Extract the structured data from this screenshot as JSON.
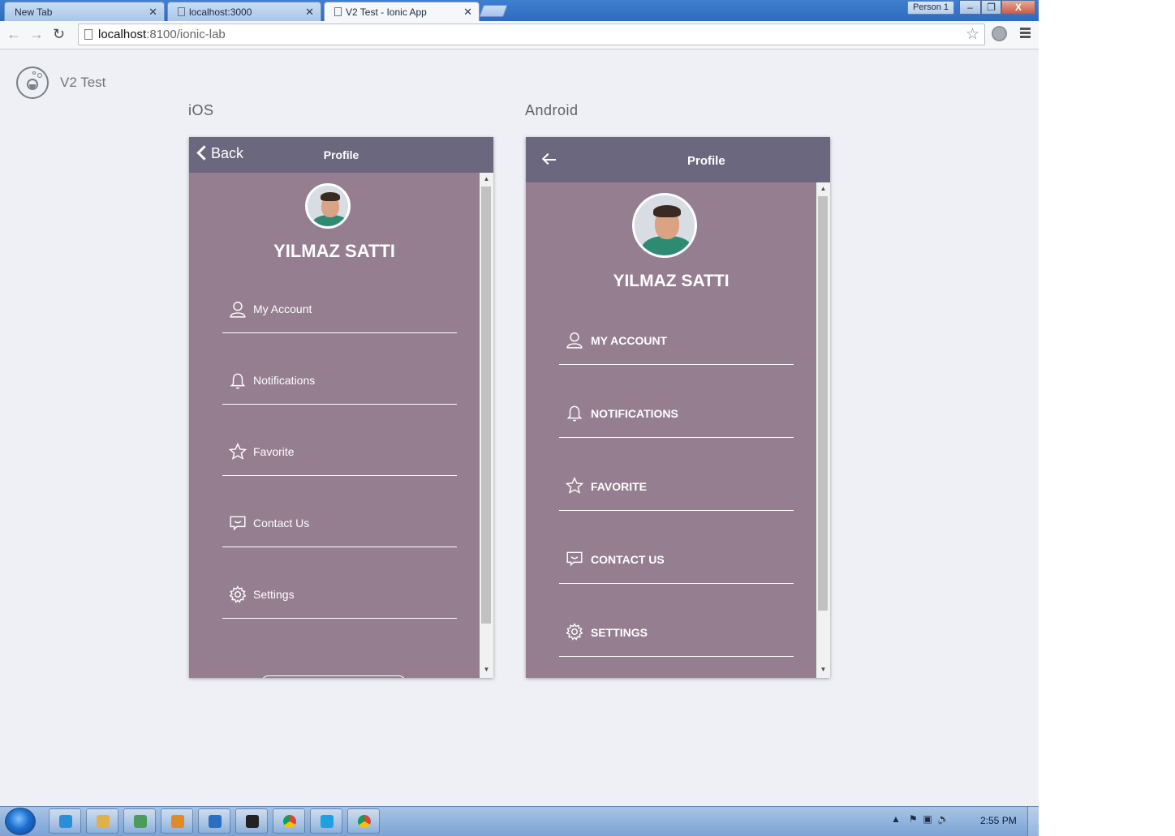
{
  "browser": {
    "tabs": [
      {
        "label": "New Tab",
        "active": false
      },
      {
        "label": "localhost:3000",
        "active": false
      },
      {
        "label": "V2 Test - Ionic App",
        "active": true
      }
    ],
    "profile": "Person 1",
    "window_buttons": {
      "minimize": "–",
      "restore": "❐",
      "close": "X"
    },
    "url_host": "localhost",
    "url_rest": ":8100/ionic-lab"
  },
  "lab": {
    "app_name": "V2 Test",
    "platforms": {
      "ios": {
        "label": "iOS",
        "back_label": "Back",
        "title": "Profile"
      },
      "android": {
        "label": "Android",
        "title": "Profile"
      }
    }
  },
  "profile": {
    "name": "YILMAZ SATTI",
    "menu_ios": [
      "My Account",
      "Notifications",
      "Favorite",
      "Contact Us",
      "Settings"
    ],
    "menu_android": [
      "MY ACCOUNT",
      "NOTIFICATIONS",
      "FAVORITE",
      "CONTACT US",
      "SETTINGS"
    ],
    "menu_icons": [
      "person-icon",
      "bell-icon",
      "star-icon",
      "chat-icon",
      "gear-icon"
    ]
  },
  "colors": {
    "header": "#6b677f",
    "content": "#957e8f",
    "page_bg": "#eef0f5"
  },
  "taskbar": {
    "clock": "2:55 PM",
    "apps": [
      "internet-explorer-icon",
      "file-explorer-icon",
      "photo-viewer-icon",
      "media-player-icon",
      "vscode-icon",
      "command-prompt-icon",
      "chrome-icon",
      "skype-icon",
      "chrome-canary-icon"
    ]
  }
}
